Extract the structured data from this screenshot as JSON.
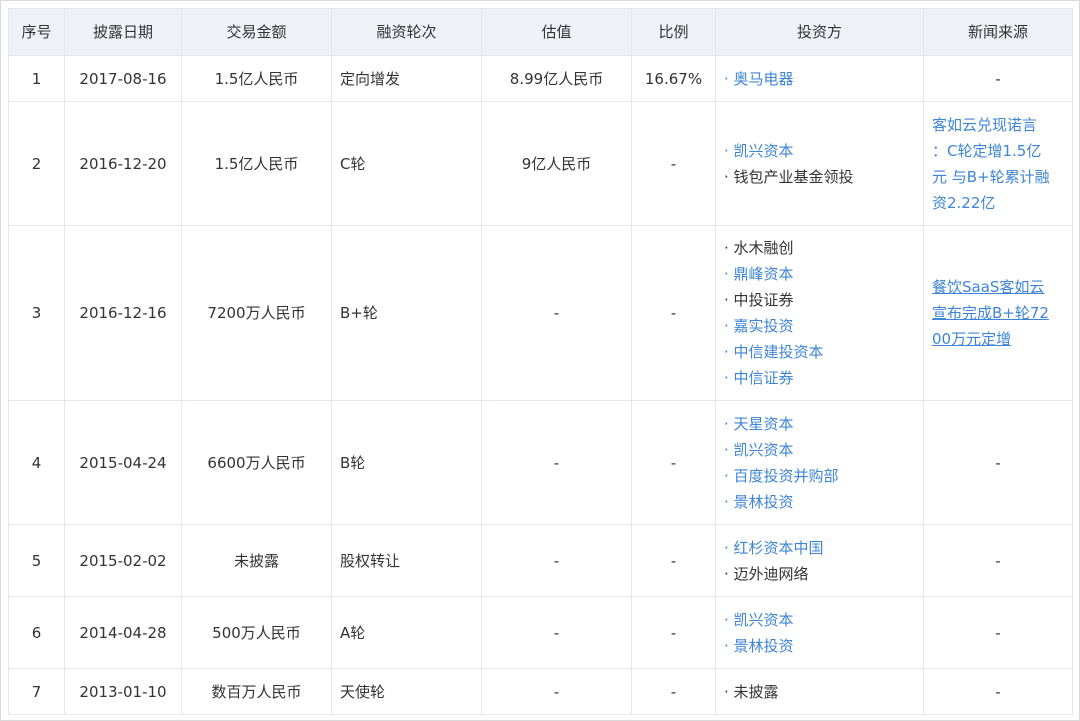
{
  "headers": [
    "序号",
    "披露日期",
    "交易金额",
    "融资轮次",
    "估值",
    "比例",
    "投资方",
    "新闻来源"
  ],
  "rows": [
    {
      "no": "1",
      "date": "2017-08-16",
      "amount": "1.5亿人民币",
      "round": "定向增发",
      "valuation": "8.99亿人民币",
      "ratio": "16.67%",
      "investors": [
        {
          "name": "· 奥马电器",
          "link": true
        }
      ],
      "news": "-"
    },
    {
      "no": "2",
      "date": "2016-12-20",
      "amount": "1.5亿人民币",
      "round": "C轮",
      "valuation": "9亿人民币",
      "ratio": "-",
      "investors": [
        {
          "name": "· 凯兴资本",
          "link": true
        },
        {
          "name": "· 钱包产业基金领投",
          "link": false
        }
      ],
      "news_lines": [
        "客如云兑现诺言",
        "：C轮定增1.5亿",
        "元 与B+轮累计融",
        "资2.22亿"
      ]
    },
    {
      "no": "3",
      "date": "2016-12-16",
      "amount": "7200万人民币",
      "round": "B+轮",
      "valuation": "-",
      "ratio": "-",
      "investors": [
        {
          "name": "· 水木融创",
          "link": false
        },
        {
          "name": "· 鼎峰资本",
          "link": true
        },
        {
          "name": "· 中投证券",
          "link": false
        },
        {
          "name": "· 嘉实投资",
          "link": true
        },
        {
          "name": "· 中信建投资本",
          "link": true
        },
        {
          "name": "· 中信证券",
          "link": true
        }
      ],
      "news_lines": [
        "餐饮SaaS客如云",
        "宣布完成B+轮72",
        "00万元定增"
      ]
    },
    {
      "no": "4",
      "date": "2015-04-24",
      "amount": "6600万人民币",
      "round": "B轮",
      "valuation": "-",
      "ratio": "-",
      "investors": [
        {
          "name": "· 天星资本",
          "link": true
        },
        {
          "name": "· 凯兴资本",
          "link": true
        },
        {
          "name": "· 百度投资并购部",
          "link": true
        },
        {
          "name": "· 景林投资",
          "link": true
        }
      ],
      "news": "-"
    },
    {
      "no": "5",
      "date": "2015-02-02",
      "amount": "未披露",
      "round": "股权转让",
      "valuation": "-",
      "ratio": "-",
      "investors": [
        {
          "name": "· 红杉资本中国",
          "link": true
        },
        {
          "name": "· 迈外迪网络",
          "link": false
        }
      ],
      "news": "-"
    },
    {
      "no": "6",
      "date": "2014-04-28",
      "amount": "500万人民币",
      "round": "A轮",
      "valuation": "-",
      "ratio": "-",
      "investors": [
        {
          "name": "· 凯兴资本",
          "link": true
        },
        {
          "name": "· 景林投资",
          "link": true
        }
      ],
      "news": "-"
    },
    {
      "no": "7",
      "date": "2013-01-10",
      "amount": "数百万人民币",
      "round": "天使轮",
      "valuation": "-",
      "ratio": "-",
      "investors": [
        {
          "name": "· 未披露",
          "link": false
        }
      ],
      "news": "-"
    }
  ],
  "colors": {
    "link": "#3d85d6",
    "header_bg": "#eef2f7",
    "border": "#e4e7ec"
  }
}
